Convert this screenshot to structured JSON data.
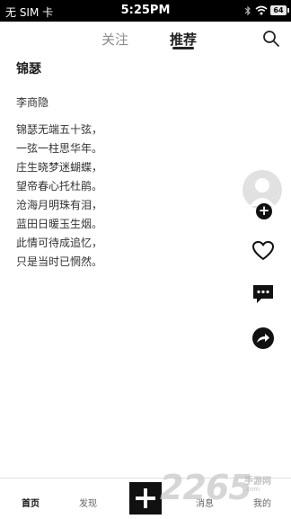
{
  "status_bar": {
    "carrier": "无 SIM 卡",
    "time": "5:25PM",
    "battery": "64"
  },
  "top_nav": {
    "tabs": [
      "关注",
      "推荐"
    ],
    "active_tab": "推荐"
  },
  "poem": {
    "title": "锦瑟",
    "author": "李商隐",
    "lines": [
      "锦瑟无端五十弦，",
      "一弦一柱思华年。",
      "庄生晓梦迷蝴蝶，",
      "望帝春心托杜鹃。",
      "沧海月明珠有泪，",
      "蓝田日暖玉生烟。",
      "此情可待成追忆，",
      "只是当时已惘然。"
    ]
  },
  "side_actions": {
    "follow_label": "+",
    "icons": [
      "avatar",
      "heart-icon",
      "comment-icon",
      "share-icon"
    ]
  },
  "bottom_nav": {
    "tabs": [
      "首页",
      "发现",
      "消息",
      "我的"
    ],
    "active_tab": "首页",
    "publish_icon": "plus-icon"
  },
  "watermark": {
    "number": "2265",
    "site": "手游网",
    "domain": ".com"
  },
  "colors": {
    "active": "#222222",
    "inactive": "#8c8c8c",
    "accent": "#111111"
  }
}
